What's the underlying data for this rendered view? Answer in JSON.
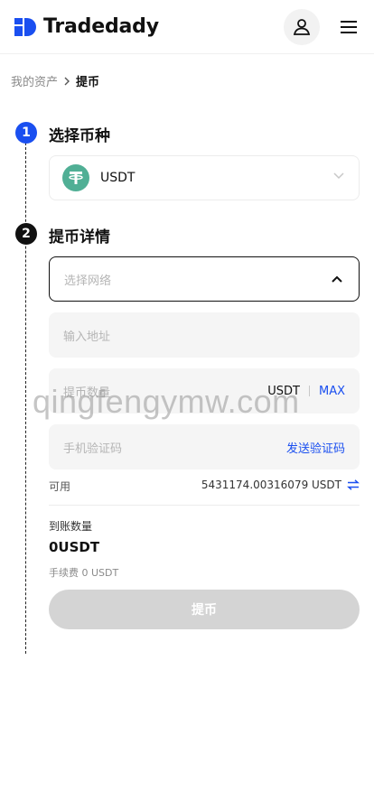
{
  "header": {
    "brand": "Tradedady",
    "brand_color": "#1a4ff0",
    "icons": [
      "user-icon",
      "hamburger-menu-icon"
    ]
  },
  "breadcrumb": {
    "parent": "我的资产",
    "current": "提币"
  },
  "steps": [
    {
      "number": "1",
      "title": "选择币种"
    },
    {
      "number": "2",
      "title": "提币详情"
    }
  ],
  "coin": {
    "name": "USDT",
    "icon": "tether-icon",
    "icon_color": "#50af95"
  },
  "form": {
    "network_placeholder": "选择网络",
    "address_placeholder": "输入地址",
    "amount_placeholder": "提币数量",
    "amount_unit": "USDT",
    "max_label": "MAX",
    "code_placeholder": "手机验证码",
    "send_code_label": "发送验证码"
  },
  "available": {
    "label": "可用",
    "value": "5431174.00316079 USDT"
  },
  "receive": {
    "label": "到账数量",
    "amount": "0USDT",
    "fee": "手续费 0 USDT"
  },
  "submit_label": "提币",
  "watermark": "qingfengymw.com",
  "colors": {
    "accent": "#1a4ff0",
    "disabled_button": "#d4d4d4",
    "field_bg": "#f5f5f5"
  }
}
